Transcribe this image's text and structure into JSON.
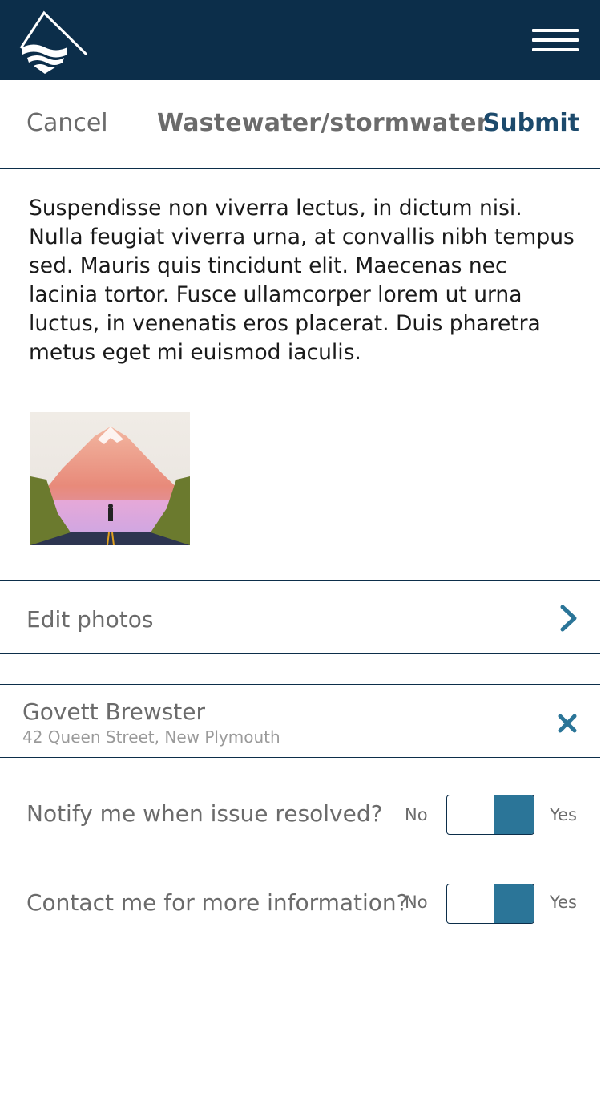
{
  "header": {
    "logo_icon": "mountain-waves-logo",
    "menu_icon": "hamburger-menu-icon",
    "background": "#0c2e4a"
  },
  "nav": {
    "cancel_label": "Cancel",
    "title": "Wastewater/stormwater",
    "submit_label": "Submit"
  },
  "description": "Suspendisse non viverra lectus, in dictum nisi. Nulla feugiat viverra urna, at convallis nibh tempus sed. Mauris quis tincidunt elit. Maecenas nec lacinia tortor. Fusce ullamcorper lorem ut urna luctus, in venenatis eros placerat. Duis pharetra metus eget mi euismod iaculis.",
  "photos": [
    {
      "thumbnail_icon": "mountain-road-photo"
    }
  ],
  "edit_photos": {
    "label": "Edit photos",
    "icon": "chevron-right-icon"
  },
  "location": {
    "name": "Govett Brewster",
    "address": "42 Queen Street, New Plymouth",
    "clear_icon": "close-icon"
  },
  "toggles": [
    {
      "label": "Notify me when issue resolved?",
      "no_label": "No",
      "yes_label": "Yes",
      "value": "Yes"
    },
    {
      "label": "Contact me for more information?",
      "no_label": "No",
      "yes_label": "Yes",
      "value": "Yes"
    }
  ],
  "colors": {
    "primary": "#0c2e4a",
    "accent": "#2b7598",
    "link": "#1c4a6c"
  }
}
